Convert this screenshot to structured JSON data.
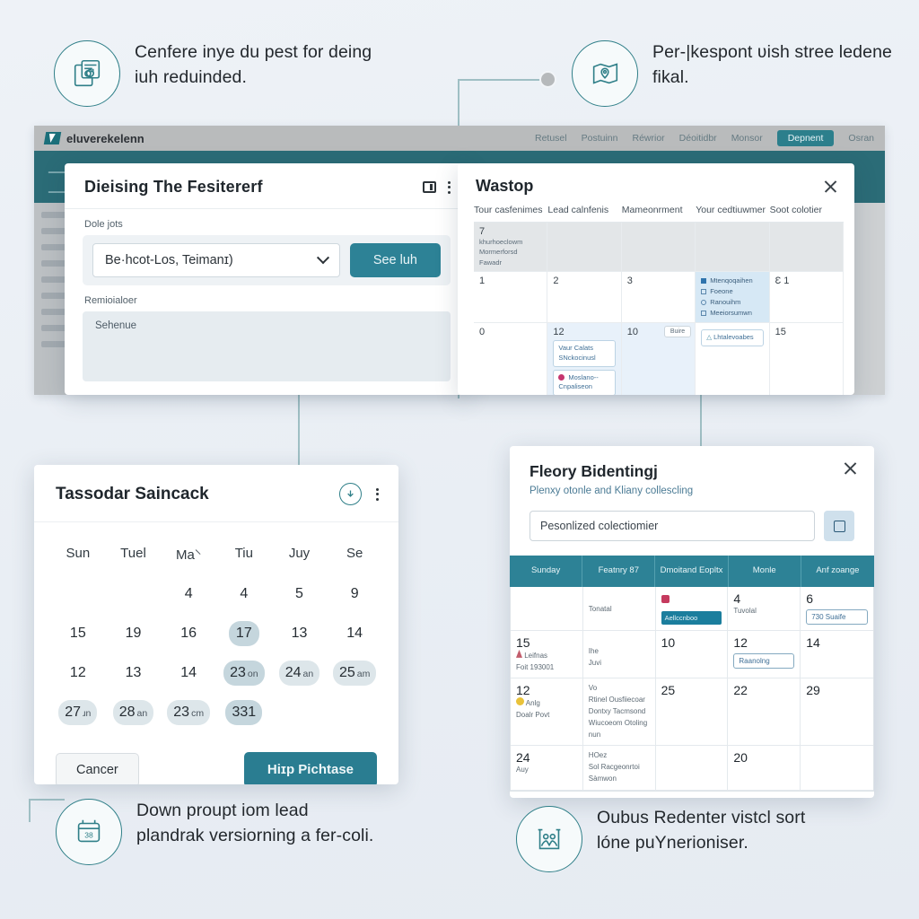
{
  "callouts": {
    "top_left": {
      "icon": "document-sync-icon",
      "text": "Cenfere inye du pest for deing iuh reduinded."
    },
    "top_right": {
      "icon": "map-pin-icon",
      "text": "Per-|kespont ʋish stree ledene fikal."
    },
    "bottom_left": {
      "icon": "calendar-38-icon",
      "text": "Down proupt iom lead plandrak versiorning a fer-coli."
    },
    "bottom_right": {
      "icon": "people-board-icon",
      "text": "Oubus Redenter vistcl sort lóne puYnerioniser."
    }
  },
  "background_window": {
    "brand": "eluverekelenn",
    "nav": [
      "Retusel",
      "Postuinn",
      "Réwrior",
      "Déoitidbr",
      "Monsor"
    ],
    "nav_active": "Depnent",
    "nav_user": "Osran",
    "sidebar_placeholder_rows": 9
  },
  "left_dialog": {
    "title": "Dieising The Fesitererf",
    "field_label": "Dole jots",
    "select_value": "Be·hcot-Los, Teimanɪ)",
    "submit_label": "See luh",
    "section_label": "Remioialoer",
    "subfield_text": "Sehenue",
    "icons": [
      "window-icon",
      "kebab-menu-icon"
    ]
  },
  "right_dialog": {
    "title": "Wastop",
    "columns": [
      "Tour casfenimes",
      "Lead calnfenis",
      "Mameonrment",
      "Your cedtiuwmer",
      "Soot colotier"
    ],
    "rows": [
      [
        {
          "num": "7",
          "note": "khurhoeclowm Mormerforsd Fawadr",
          "style": "shade"
        },
        {
          "num": "",
          "style": "shade"
        },
        {
          "num": "",
          "style": "shade"
        },
        {
          "num": "",
          "style": "shade"
        },
        {
          "num": "",
          "style": "shade"
        }
      ],
      [
        {
          "num": "1"
        },
        {
          "num": "2"
        },
        {
          "num": "3"
        },
        {
          "num": "",
          "style": "blue",
          "list": [
            "Mtenqoqaihen",
            "Foeone",
            "Ranouihm",
            "Meeiorsumwn"
          ]
        },
        {
          "num": "Ɛ 1"
        }
      ],
      [
        {
          "num": "0"
        },
        {
          "num": "12",
          "style": "lite",
          "chips": [
            "Vaur Calats SNckocinusl",
            "Moslano-- Cnpaliseon"
          ]
        },
        {
          "num": "10",
          "style": "lite",
          "tag": "Buire"
        },
        {
          "num": "",
          "chip_outline": "Lhtalevoabes"
        },
        {
          "num": "15"
        }
      ]
    ]
  },
  "date_picker": {
    "title": "Tassodar Saincack",
    "icons": [
      "download-circle-icon",
      "kebab-menu-icon"
    ],
    "day_headers": [
      "Sun",
      "Tuel",
      "Ma⸌",
      "Tiu",
      "Juy",
      "Se"
    ],
    "weeks": [
      [
        {
          "d": ""
        },
        {
          "d": ""
        },
        {
          "d": "4"
        },
        {
          "d": "4"
        },
        {
          "d": "5"
        },
        {
          "d": "9"
        }
      ],
      [
        {
          "d": "15"
        },
        {
          "d": "19"
        },
        {
          "d": "16"
        },
        {
          "d": "17",
          "pill": "sel"
        },
        {
          "d": "13"
        },
        {
          "d": "14"
        }
      ],
      [
        {
          "d": "12"
        },
        {
          "d": "13"
        },
        {
          "d": "14"
        },
        {
          "d": "23",
          "u": "on",
          "pill": "sel"
        },
        {
          "d": "24",
          "u": "an",
          "pill": "soft"
        },
        {
          "d": "25",
          "u": "am",
          "pill": "soft"
        }
      ],
      [
        {
          "d": "27",
          "u": "ɹn",
          "pill": "soft"
        },
        {
          "d": "28",
          "u": "an",
          "pill": "soft"
        },
        {
          "d": "23",
          "u": "cm",
          "pill": "soft"
        },
        {
          "d": "331",
          "pill": "sel"
        },
        {
          "d": ""
        },
        {
          "d": ""
        }
      ]
    ],
    "cancel_label": "Cancer",
    "confirm_label": "Hiɪp Pichtase"
  },
  "booking_panel": {
    "title": "Fleory Bidentingj",
    "subtitle": "Plenxy otonle and Kliany collescling",
    "input_value": "Pesonlized colectiomier",
    "edit_icon": "edit-icon",
    "columns": [
      "Sunday",
      "Featnry 87",
      "Dmoitand Eopltx",
      "Monle",
      "Anf zoange"
    ],
    "rows": [
      [
        {
          "num": ""
        },
        {
          "num": "",
          "small": "Tonatal"
        },
        {
          "num": "",
          "flag": "flag-red",
          "bar": "Aellccnboo"
        },
        {
          "num": "4",
          "small": "Tuvolal"
        },
        {
          "num": "6",
          "outline": "730 Suaife"
        }
      ],
      [
        {
          "num": "15",
          "small": "Leifnas",
          "small2": "Foit 193001",
          "marker": "dot-red"
        },
        {
          "num": "",
          "small": "Ihe",
          "small2": "Juvi"
        },
        {
          "num": "10"
        },
        {
          "num": "12",
          "outline": "Raanolng"
        },
        {
          "num": "14"
        }
      ],
      [
        {
          "num": "12",
          "small": "Anlg",
          "small2": "Doalr Povt",
          "marker": "dot-yellow"
        },
        {
          "num": "",
          "small": "Vo",
          "small2": "Rtinel Ousfiiecoar Dontxy Tacmsond Wiucoeom Otoling nun"
        },
        {
          "num": "25"
        },
        {
          "num": "22"
        },
        {
          "num": "29"
        }
      ],
      [
        {
          "num": "24",
          "small": "Auy"
        },
        {
          "num": "",
          "small": "HOez",
          "small2": "Sol Racgeonrtoi Sàmwon"
        },
        {
          "num": ""
        },
        {
          "num": "20"
        },
        {
          "num": ""
        }
      ]
    ]
  },
  "colors": {
    "accent_teal": "#2d8296",
    "badge_outline": "#2f7f88",
    "page_bg": "#eef2f6",
    "selected_day": "#c5d6dd",
    "event_blue": "#d6e8f5"
  }
}
